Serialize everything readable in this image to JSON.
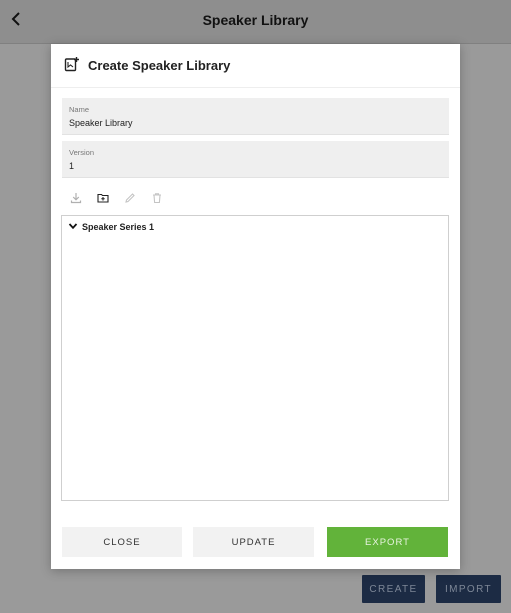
{
  "app": {
    "title": "Speaker Library",
    "back_icon": "chevron-left-icon"
  },
  "background_buttons": {
    "create_label": "CREATE",
    "import_label": "IMPORT"
  },
  "dialog": {
    "title": "Create Speaker Library",
    "header_icon": "add-library-icon",
    "fields": {
      "name": {
        "label": "Name",
        "value": "Speaker Library"
      },
      "version": {
        "label": "Version",
        "value": "1"
      }
    },
    "toolbar": [
      "download-icon",
      "folder-add-icon",
      "edit-icon",
      "delete-icon"
    ],
    "tree": {
      "items": [
        {
          "label": "Speaker Series 1",
          "expanded": true
        }
      ]
    },
    "buttons": {
      "close_label": "CLOSE",
      "update_label": "UPDATE",
      "export_label": "EXPORT"
    }
  },
  "colors": {
    "export_button": "#62b33a",
    "background_button": "#1c2b44",
    "overlay": "#9a9a9a"
  }
}
